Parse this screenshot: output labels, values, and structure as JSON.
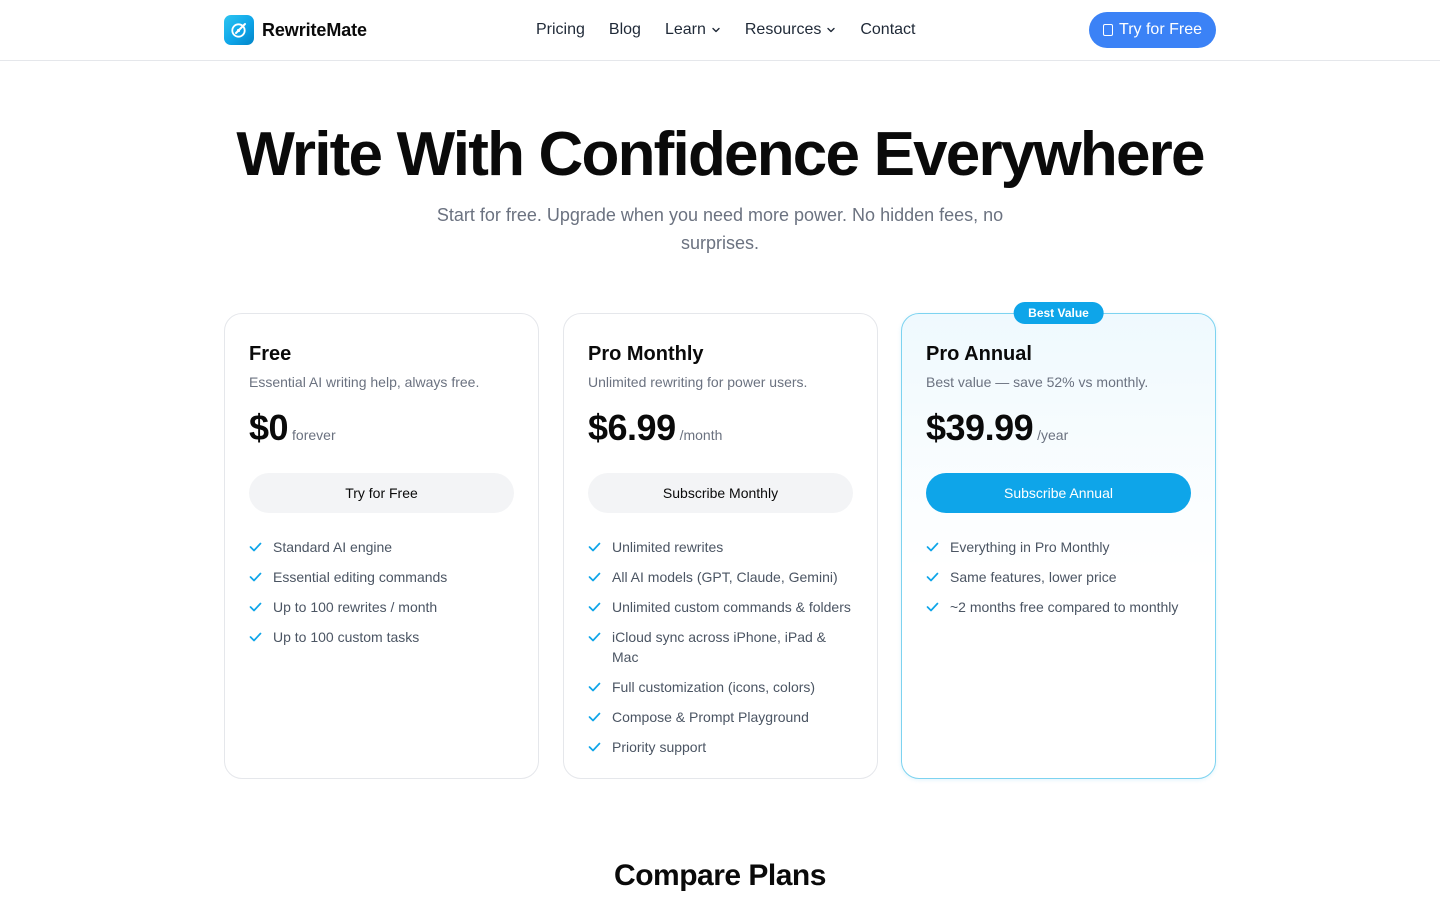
{
  "brand": {
    "name": "RewriteMate"
  },
  "nav": {
    "items": [
      {
        "label": "Pricing",
        "dropdown": false
      },
      {
        "label": "Blog",
        "dropdown": false
      },
      {
        "label": "Learn",
        "dropdown": true
      },
      {
        "label": "Resources",
        "dropdown": true
      },
      {
        "label": "Contact",
        "dropdown": false
      }
    ],
    "cta_label": "Try for Free"
  },
  "hero": {
    "title": "Write With Confidence Everywhere",
    "subtitle": "Start for free. Upgrade when you need more power. No hidden fees, no surprises."
  },
  "plans": [
    {
      "name": "Free",
      "description": "Essential AI writing help, always free.",
      "price": "$0",
      "period": "forever",
      "button": "Try for Free",
      "features": [
        "Standard AI engine",
        "Essential editing commands",
        "Up to 100 rewrites / month",
        "Up to 100 custom tasks"
      ]
    },
    {
      "name": "Pro Monthly",
      "description": "Unlimited rewriting for power users.",
      "price": "$6.99",
      "period": "/month",
      "button": "Subscribe Monthly",
      "features": [
        "Unlimited rewrites",
        "All AI models (GPT, Claude, Gemini)",
        "Unlimited custom commands & folders",
        "iCloud sync across iPhone, iPad & Mac",
        "Full customization (icons, colors)",
        "Compose & Prompt Playground",
        "Priority support"
      ]
    },
    {
      "name": "Pro Annual",
      "badge": "Best Value",
      "description": "Best value — save 52% vs monthly.",
      "price": "$39.99",
      "period": "/year",
      "button": "Subscribe Annual",
      "features": [
        "Everything in Pro Monthly",
        "Same features, lower price",
        "~2 months free compared to monthly"
      ]
    }
  ],
  "compare": {
    "title": "Compare Plans"
  },
  "colors": {
    "accent": "#0ea5e9",
    "cta": "#3b82f6",
    "check": "#0ea5e9"
  },
  "icons": {
    "logo": "pen-target-icon",
    "chevron": "chevron-down-icon",
    "check": "check-icon",
    "cta": "app-icon"
  }
}
